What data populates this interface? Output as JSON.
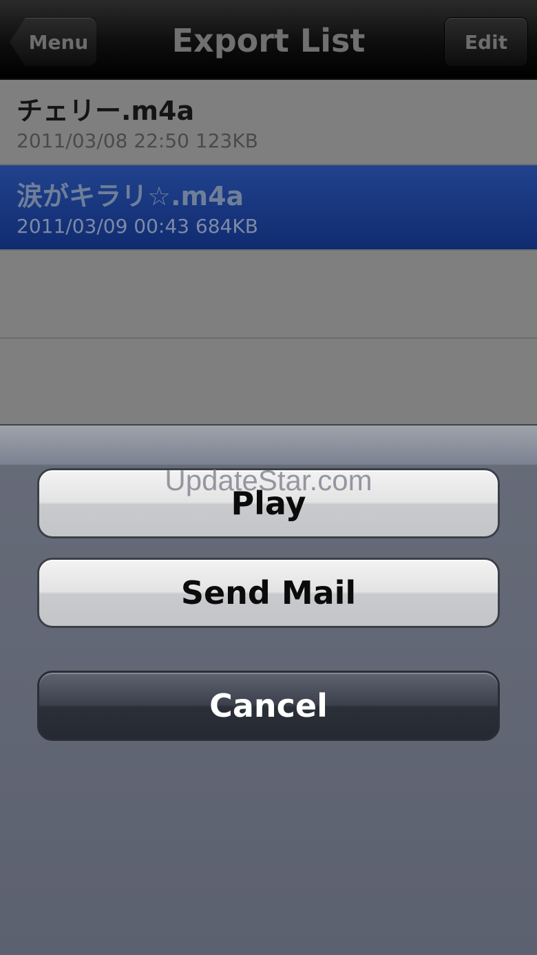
{
  "navbar": {
    "back_label": "Menu",
    "title": "Export List",
    "edit_label": "Edit"
  },
  "files": [
    {
      "name": "チェリー.m4a",
      "date": "2011/03/08 22:50",
      "size": "123KB",
      "selected": false
    },
    {
      "name": "涙がキラリ☆.m4a",
      "date": "2011/03/09 00:43",
      "size": "684KB",
      "selected": true
    }
  ],
  "action_sheet": {
    "play_label": "Play",
    "send_mail_label": "Send Mail",
    "cancel_label": "Cancel"
  },
  "watermark": "UpdateStar.com",
  "colors": {
    "selection": "#1b3a85",
    "sheet_background": "#5c6170"
  }
}
